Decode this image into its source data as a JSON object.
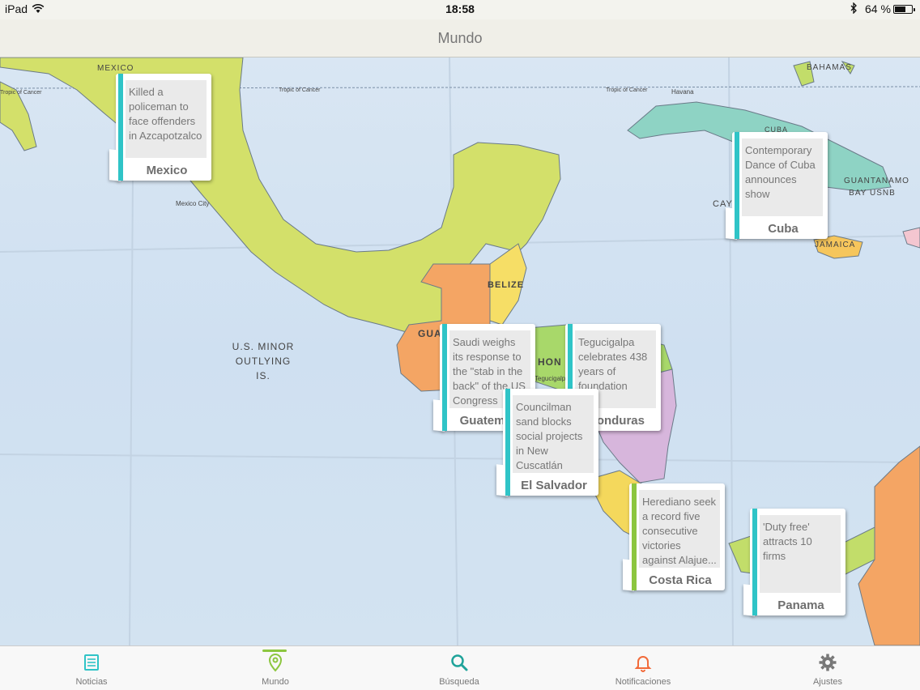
{
  "status_bar": {
    "device": "iPad",
    "time": "18:58",
    "battery_text": "64 %",
    "battery_level": 0.64
  },
  "nav": {
    "title": "Mundo"
  },
  "map": {
    "labels": {
      "mexico": "MEXICO",
      "mexico_city": "Mexico City",
      "tropic_left": "Tropic of Cancer",
      "tropic_mid": "Tropic of Cancer",
      "tropic_right": "Tropic of Cancer",
      "havana": "Havana",
      "bahamas": "BAHAMAS",
      "belize": "BELIZE",
      "guantanamo": "GUANTANAMO BAY USNB",
      "cay": "CAY",
      "jamaica": "JAMAICA",
      "cuba": "CUBA",
      "us_minor": "U.S. MINOR OUTLYING IS.",
      "gua": "GUA",
      "hon": "HON",
      "tegucigalpa": "Tegucigalpa"
    }
  },
  "cards": [
    {
      "headline": "Killed a policeman to face offenders in Azcapotzalco",
      "country": "Mexico",
      "accent": "#2fc4c7"
    },
    {
      "headline": "Contemporary Dance of Cuba announces show",
      "country": "Cuba",
      "accent": "#2fc4c7"
    },
    {
      "headline": "Saudi weighs its response to the \"stab in the back\" of the US Congress",
      "country": "Guatemala",
      "accent": "#2fc4c7"
    },
    {
      "headline": "Tegucigalpa celebrates 438 years of foundation",
      "country": "Honduras",
      "accent": "#2fc4c7"
    },
    {
      "headline": "Councilman sand blocks social projects in New Cuscatlán",
      "country": "El Salvador",
      "accent": "#2fc4c7"
    },
    {
      "headline": "Herediano seek a record five consecutive victories against Alajue...",
      "country": "Costa Rica",
      "accent": "#8cc63f"
    },
    {
      "headline": "'Duty free' attracts 10 firms",
      "country": "Panama",
      "accent": "#2fc4c7"
    }
  ],
  "tabs": [
    {
      "label": "Noticias",
      "icon": "newspaper-icon",
      "color": "#2fc4c7"
    },
    {
      "label": "Mundo",
      "icon": "map-pin-icon",
      "color": "#8cc63f",
      "active": true
    },
    {
      "label": "Búsqueda",
      "icon": "search-icon",
      "color": "#1fa39a"
    },
    {
      "label": "Notificaciones",
      "icon": "bell-icon",
      "color": "#f26b3a"
    },
    {
      "label": "Ajustes",
      "icon": "gear-icon",
      "color": "#777777"
    }
  ]
}
